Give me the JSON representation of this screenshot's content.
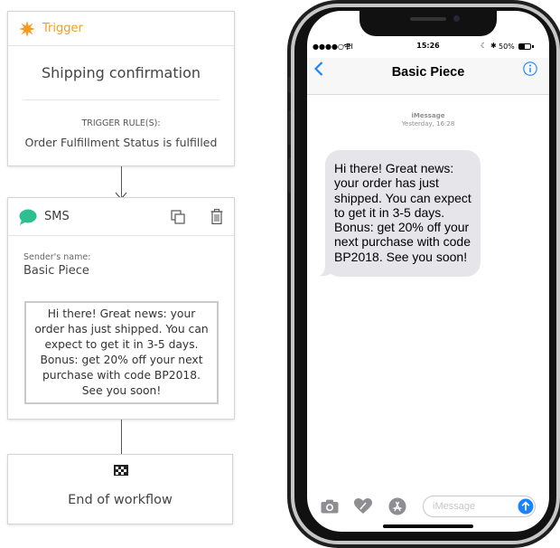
{
  "trigger": {
    "header_label": "Trigger",
    "title": "Shipping confirmation",
    "rules_label": "TRIGGER RULE(S):",
    "rule_text": "Order Fulfillment Status is fulfilled"
  },
  "sms": {
    "header_label": "SMS",
    "sender_label": "Sender's name:",
    "sender_value": "Basic Piece",
    "message": "Hi there! Great news: your order has just shipped. You can expect to get it in 3-5 days. Bonus: get 20% off your next purchase with code BP2018. See you soon!"
  },
  "end": {
    "label": "End of workflow"
  },
  "phone": {
    "status": {
      "carrier": "●●●●○ EI",
      "time": "15:26",
      "battery": "50%"
    },
    "nav": {
      "title": "Basic Piece"
    },
    "thread": {
      "service": "iMessage",
      "timestamp": "Yesterday, 16:28"
    },
    "bubble_lines": [
      "Hi there! Great news:",
      "your order has just",
      "shipped. You can expect",
      "to get it in 3-5 days.",
      "Bonus: get 20% off your",
      "next purchase with code",
      "BP2018. See you soon!"
    ],
    "composer": {
      "placeholder": "iMessage"
    }
  },
  "colors": {
    "trigger_accent": "#f39c1f",
    "sms_accent": "#2ebf91",
    "ios_blue": "#1a82fb",
    "bubble_gray": "#e5e5ea"
  }
}
